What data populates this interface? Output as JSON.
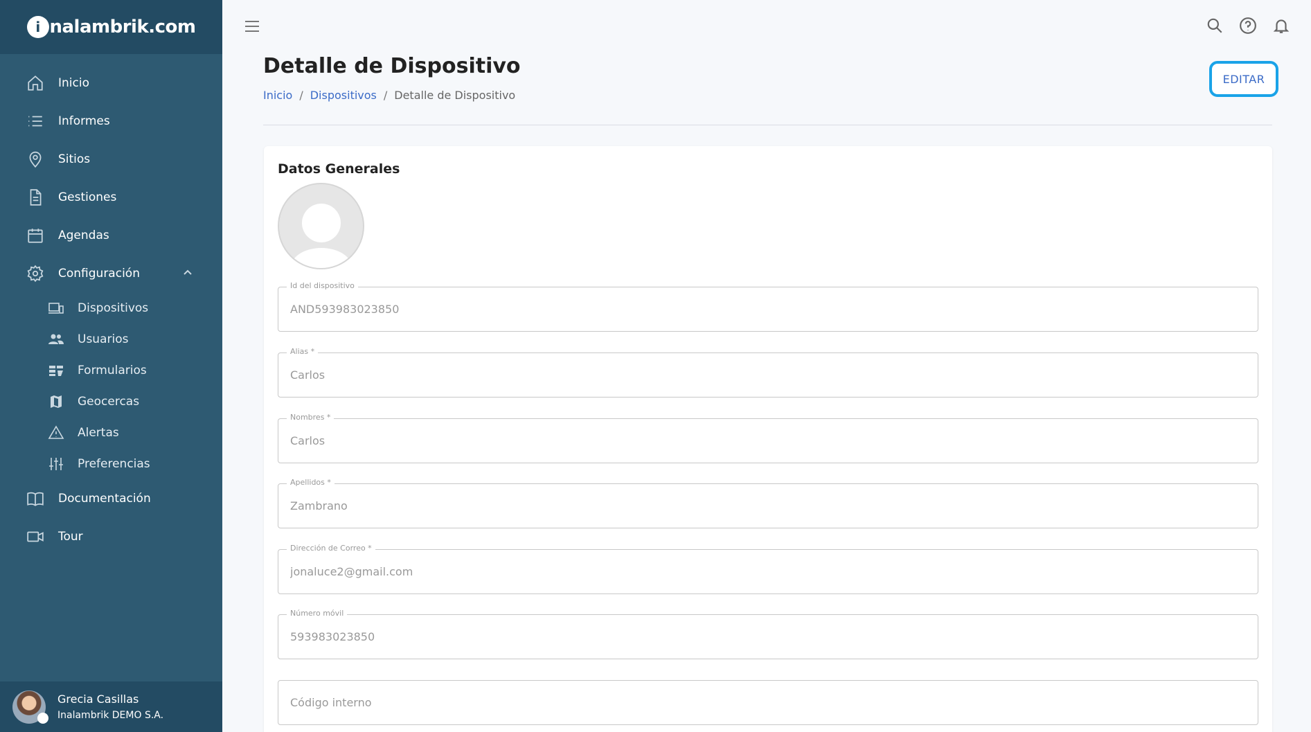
{
  "brand": {
    "logo_letter": "i",
    "logo_rest": "nalambrik.com"
  },
  "sidebar": {
    "items": [
      {
        "label": "Inicio"
      },
      {
        "label": "Informes"
      },
      {
        "label": "Sitios"
      },
      {
        "label": "Gestiones"
      },
      {
        "label": "Agendas"
      },
      {
        "label": "Configuración"
      },
      {
        "label": "Documentación"
      },
      {
        "label": "Tour"
      }
    ],
    "sub_items": [
      {
        "label": "Dispositivos"
      },
      {
        "label": "Usuarios"
      },
      {
        "label": "Formularios"
      },
      {
        "label": "Geocercas"
      },
      {
        "label": "Alertas"
      },
      {
        "label": "Preferencias"
      }
    ]
  },
  "user": {
    "name": "Grecia Casillas",
    "org": "Inalambrik DEMO S.A."
  },
  "header": {
    "title": "Detalle de Dispositivo",
    "breadcrumb": [
      "Inicio",
      "Dispositivos",
      "Detalle de Dispositivo"
    ],
    "breadcrumb_sep": "/",
    "edit_label": "EDITAR"
  },
  "card": {
    "title": "Datos Generales",
    "fields": [
      {
        "label": "Id del dispositivo",
        "value": "AND593983023850"
      },
      {
        "label": "Alias *",
        "value": "Carlos"
      },
      {
        "label": "Nombres *",
        "value": "Carlos"
      },
      {
        "label": "Apellidos *",
        "value": "Zambrano"
      },
      {
        "label": "Dirección de Correo *",
        "value": "jonaluce2@gmail.com"
      },
      {
        "label": "Número móvil",
        "value": "593983023850"
      },
      {
        "label": "",
        "value": "",
        "placeholder": "Código interno"
      }
    ]
  },
  "colors": {
    "sidebar": "#2e5a72",
    "sidebar_dark": "#234b63",
    "accent": "#3b6bc7",
    "focus": "#1aa3e8"
  }
}
